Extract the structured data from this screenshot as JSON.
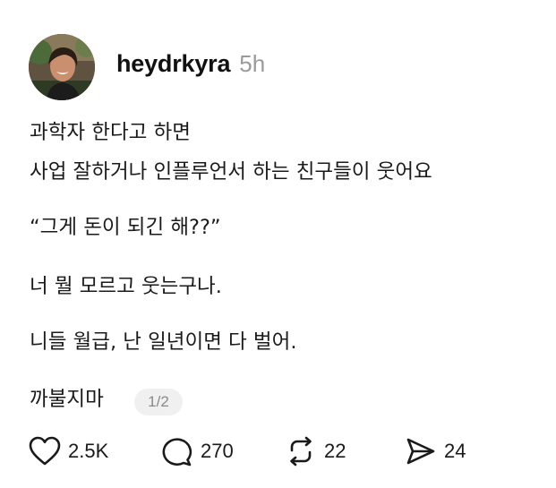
{
  "post": {
    "username": "heydrkyra",
    "time": "5h",
    "lines": [
      "과학자 한다고 하면",
      "사업 잘하거나 인플루언서 하는 친구들이 웃어요",
      "“그게 돈이 되긴 해??”",
      "너 뭘 모르고 웃는구나.",
      "니들 월급, 난 일년이면 다 벌어.",
      "까불지마"
    ],
    "page_indicator": "1/2"
  },
  "actions": {
    "likes": "2.5K",
    "replies": "270",
    "reposts": "22",
    "shares": "24"
  },
  "icons": {
    "like": "heart-icon",
    "reply": "comment-bubble-icon",
    "repost": "repost-icon",
    "share": "send-icon"
  }
}
